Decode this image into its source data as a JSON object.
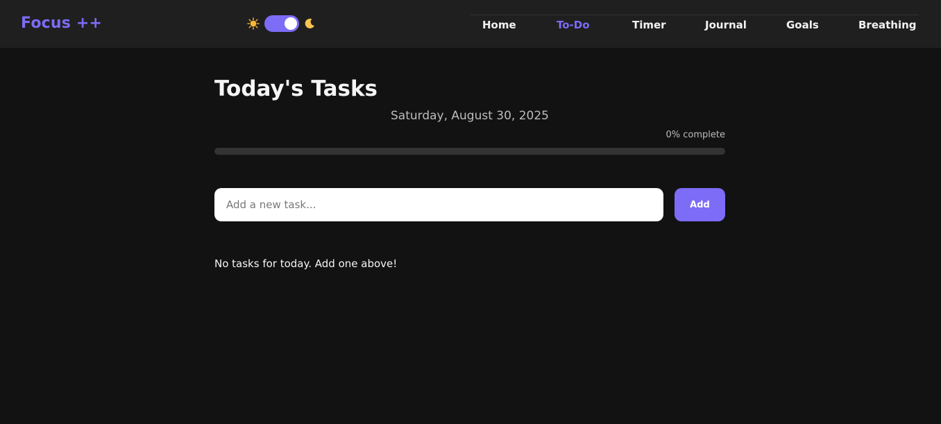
{
  "app": {
    "brand": "Focus ++",
    "accent_color": "#7c6cf6",
    "background_color": "#121212"
  },
  "theme_toggle": {
    "sun_icon": "sun-icon",
    "moon_icon": "moon-icon",
    "mode": "dark"
  },
  "nav": {
    "active": "To-Do",
    "items": [
      {
        "label": "Home"
      },
      {
        "label": "To-Do"
      },
      {
        "label": "Timer"
      },
      {
        "label": "Journal"
      },
      {
        "label": "Goals"
      },
      {
        "label": "Breathing"
      }
    ]
  },
  "main": {
    "title": "Today's Tasks",
    "date": "Saturday, August 30, 2025",
    "progress": {
      "label": "0% complete",
      "percent": 0
    },
    "new_task": {
      "placeholder": "Add a new task...",
      "value": "",
      "button_label": "Add"
    },
    "empty_message": "No tasks for today. Add one above!"
  }
}
